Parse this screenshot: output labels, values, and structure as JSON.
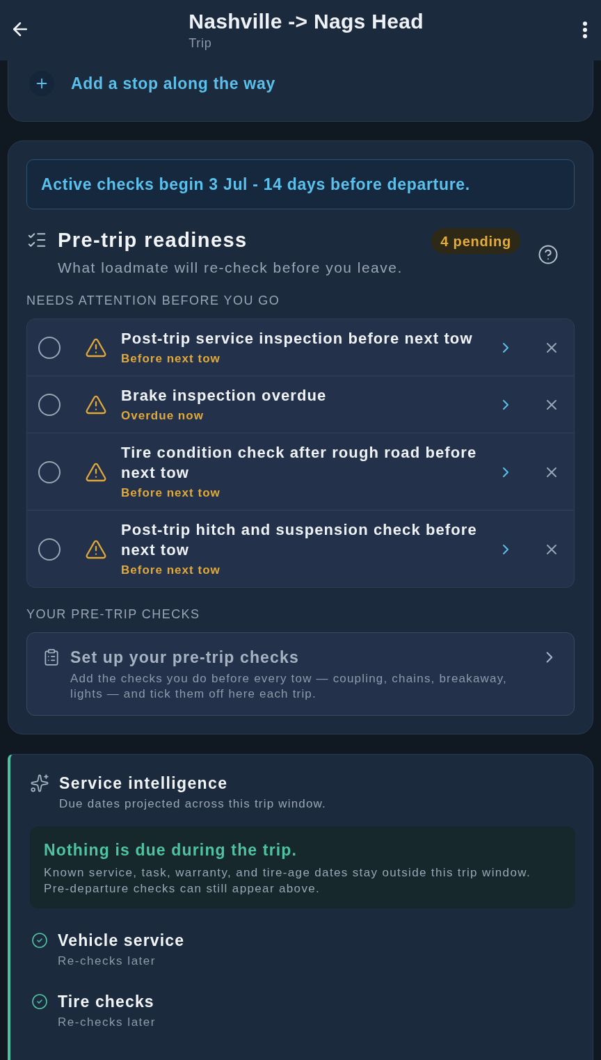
{
  "header": {
    "title": "Nashville -> Nags Head",
    "subtitle": "Trip"
  },
  "route_card": {
    "add_stop_label": "Add a stop along the way"
  },
  "readiness": {
    "banner": "Active checks begin 3 Jul - 14 days before departure.",
    "title": "Pre-trip readiness",
    "badge": "4 pending",
    "subtitle": "What loadmate will re-check before you leave.",
    "attention_heading": "NEEDS ATTENTION BEFORE YOU GO",
    "items": [
      {
        "title": "Post-trip service inspection before next tow",
        "due": "Before next tow",
        "checked": false
      },
      {
        "title": "Brake inspection overdue",
        "due": "Overdue now",
        "checked": false
      },
      {
        "title": "Tire condition check after rough road before next tow",
        "due": "Before next tow",
        "checked": false
      },
      {
        "title": "Post-trip hitch and suspension check before next tow",
        "due": "Before next tow",
        "checked": false
      }
    ],
    "checks_heading": "YOUR PRE-TRIP CHECKS",
    "setup": {
      "title": "Set up your pre-trip checks",
      "description": "Add the checks you do before every tow — coupling, chains, breakaway, lights — and tick them off here each trip."
    }
  },
  "service_intelligence": {
    "title": "Service intelligence",
    "subtitle": "Due dates projected across this trip window.",
    "status": {
      "title": "Nothing is due during the trip.",
      "description": "Known service, task, warranty, and tire-age dates stay outside this trip window. Pre-departure checks can still appear above."
    },
    "items": [
      {
        "title": "Vehicle service",
        "note": "Re-checks later"
      },
      {
        "title": "Tire checks",
        "note": "Re-checks later"
      }
    ]
  }
}
